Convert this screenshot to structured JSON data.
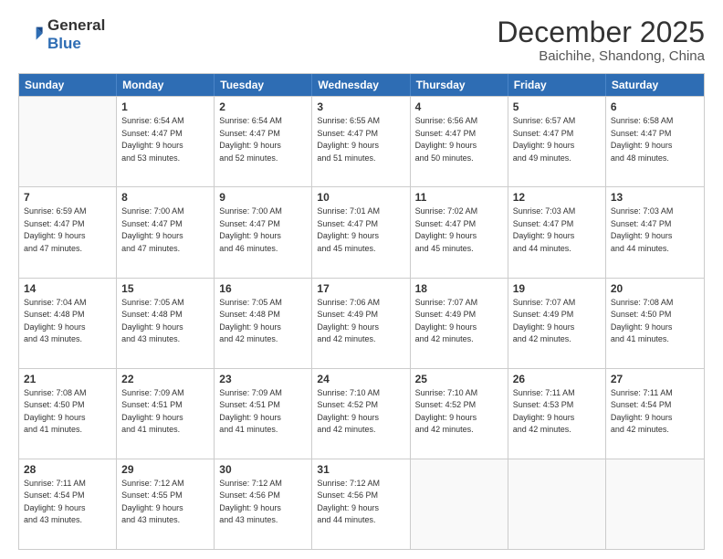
{
  "header": {
    "logo_line1": "General",
    "logo_line2": "Blue",
    "month": "December 2025",
    "location": "Baichihe, Shandong, China"
  },
  "weekdays": [
    "Sunday",
    "Monday",
    "Tuesday",
    "Wednesday",
    "Thursday",
    "Friday",
    "Saturday"
  ],
  "weeks": [
    [
      {
        "day": "",
        "info": ""
      },
      {
        "day": "1",
        "info": "Sunrise: 6:54 AM\nSunset: 4:47 PM\nDaylight: 9 hours\nand 53 minutes."
      },
      {
        "day": "2",
        "info": "Sunrise: 6:54 AM\nSunset: 4:47 PM\nDaylight: 9 hours\nand 52 minutes."
      },
      {
        "day": "3",
        "info": "Sunrise: 6:55 AM\nSunset: 4:47 PM\nDaylight: 9 hours\nand 51 minutes."
      },
      {
        "day": "4",
        "info": "Sunrise: 6:56 AM\nSunset: 4:47 PM\nDaylight: 9 hours\nand 50 minutes."
      },
      {
        "day": "5",
        "info": "Sunrise: 6:57 AM\nSunset: 4:47 PM\nDaylight: 9 hours\nand 49 minutes."
      },
      {
        "day": "6",
        "info": "Sunrise: 6:58 AM\nSunset: 4:47 PM\nDaylight: 9 hours\nand 48 minutes."
      }
    ],
    [
      {
        "day": "7",
        "info": "Sunrise: 6:59 AM\nSunset: 4:47 PM\nDaylight: 9 hours\nand 47 minutes."
      },
      {
        "day": "8",
        "info": "Sunrise: 7:00 AM\nSunset: 4:47 PM\nDaylight: 9 hours\nand 47 minutes."
      },
      {
        "day": "9",
        "info": "Sunrise: 7:00 AM\nSunset: 4:47 PM\nDaylight: 9 hours\nand 46 minutes."
      },
      {
        "day": "10",
        "info": "Sunrise: 7:01 AM\nSunset: 4:47 PM\nDaylight: 9 hours\nand 45 minutes."
      },
      {
        "day": "11",
        "info": "Sunrise: 7:02 AM\nSunset: 4:47 PM\nDaylight: 9 hours\nand 45 minutes."
      },
      {
        "day": "12",
        "info": "Sunrise: 7:03 AM\nSunset: 4:47 PM\nDaylight: 9 hours\nand 44 minutes."
      },
      {
        "day": "13",
        "info": "Sunrise: 7:03 AM\nSunset: 4:47 PM\nDaylight: 9 hours\nand 44 minutes."
      }
    ],
    [
      {
        "day": "14",
        "info": "Sunrise: 7:04 AM\nSunset: 4:48 PM\nDaylight: 9 hours\nand 43 minutes."
      },
      {
        "day": "15",
        "info": "Sunrise: 7:05 AM\nSunset: 4:48 PM\nDaylight: 9 hours\nand 43 minutes."
      },
      {
        "day": "16",
        "info": "Sunrise: 7:05 AM\nSunset: 4:48 PM\nDaylight: 9 hours\nand 42 minutes."
      },
      {
        "day": "17",
        "info": "Sunrise: 7:06 AM\nSunset: 4:49 PM\nDaylight: 9 hours\nand 42 minutes."
      },
      {
        "day": "18",
        "info": "Sunrise: 7:07 AM\nSunset: 4:49 PM\nDaylight: 9 hours\nand 42 minutes."
      },
      {
        "day": "19",
        "info": "Sunrise: 7:07 AM\nSunset: 4:49 PM\nDaylight: 9 hours\nand 42 minutes."
      },
      {
        "day": "20",
        "info": "Sunrise: 7:08 AM\nSunset: 4:50 PM\nDaylight: 9 hours\nand 41 minutes."
      }
    ],
    [
      {
        "day": "21",
        "info": "Sunrise: 7:08 AM\nSunset: 4:50 PM\nDaylight: 9 hours\nand 41 minutes."
      },
      {
        "day": "22",
        "info": "Sunrise: 7:09 AM\nSunset: 4:51 PM\nDaylight: 9 hours\nand 41 minutes."
      },
      {
        "day": "23",
        "info": "Sunrise: 7:09 AM\nSunset: 4:51 PM\nDaylight: 9 hours\nand 41 minutes."
      },
      {
        "day": "24",
        "info": "Sunrise: 7:10 AM\nSunset: 4:52 PM\nDaylight: 9 hours\nand 42 minutes."
      },
      {
        "day": "25",
        "info": "Sunrise: 7:10 AM\nSunset: 4:52 PM\nDaylight: 9 hours\nand 42 minutes."
      },
      {
        "day": "26",
        "info": "Sunrise: 7:11 AM\nSunset: 4:53 PM\nDaylight: 9 hours\nand 42 minutes."
      },
      {
        "day": "27",
        "info": "Sunrise: 7:11 AM\nSunset: 4:54 PM\nDaylight: 9 hours\nand 42 minutes."
      }
    ],
    [
      {
        "day": "28",
        "info": "Sunrise: 7:11 AM\nSunset: 4:54 PM\nDaylight: 9 hours\nand 43 minutes."
      },
      {
        "day": "29",
        "info": "Sunrise: 7:12 AM\nSunset: 4:55 PM\nDaylight: 9 hours\nand 43 minutes."
      },
      {
        "day": "30",
        "info": "Sunrise: 7:12 AM\nSunset: 4:56 PM\nDaylight: 9 hours\nand 43 minutes."
      },
      {
        "day": "31",
        "info": "Sunrise: 7:12 AM\nSunset: 4:56 PM\nDaylight: 9 hours\nand 44 minutes."
      },
      {
        "day": "",
        "info": ""
      },
      {
        "day": "",
        "info": ""
      },
      {
        "day": "",
        "info": ""
      }
    ]
  ]
}
